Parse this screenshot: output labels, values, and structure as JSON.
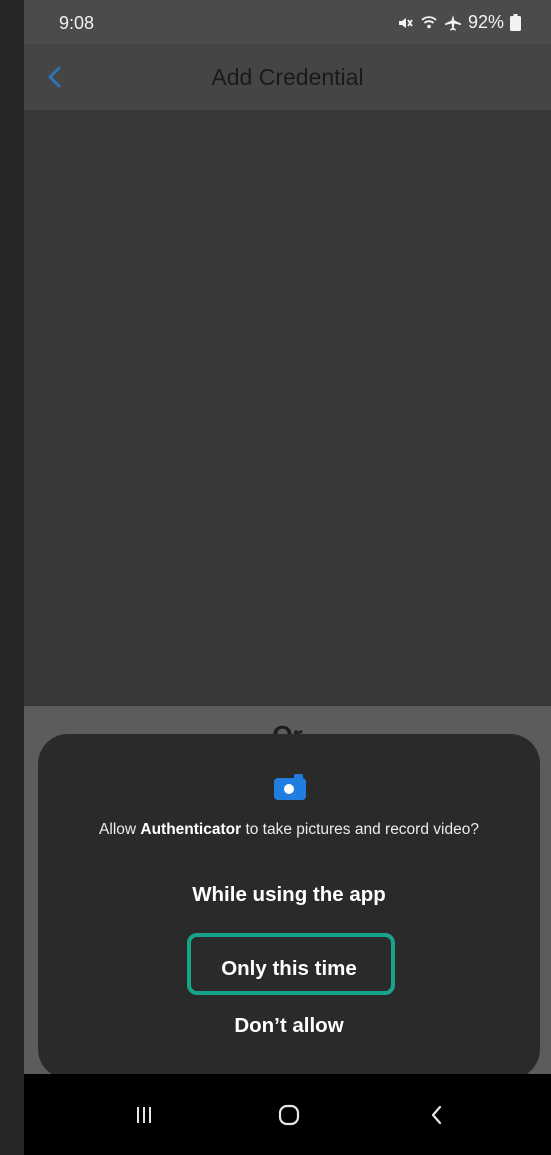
{
  "status_bar": {
    "time": "9:08",
    "battery": "92%",
    "icons": [
      "mute-icon",
      "wifi-icon",
      "airplane-icon",
      "battery-icon"
    ]
  },
  "app_bar": {
    "title": "Add Credential",
    "back_icon": "chevron-left-icon",
    "accent": "#2f73b5"
  },
  "lower_content": {
    "or_text": "Or"
  },
  "permission_dialog": {
    "icon": "camera-icon",
    "icon_color": "#1f7ee0",
    "message_prefix": "Allow ",
    "app_name": "Authenticator",
    "message_suffix": " to take pictures and record video?",
    "options": {
      "while_using": "While using the app",
      "only_this_time": "Only this time",
      "dont_allow": "Don’t allow"
    },
    "highlight_color": "#17a48a"
  },
  "nav_bar": {
    "icons": [
      "recent-apps-icon",
      "home-icon",
      "back-icon"
    ]
  }
}
